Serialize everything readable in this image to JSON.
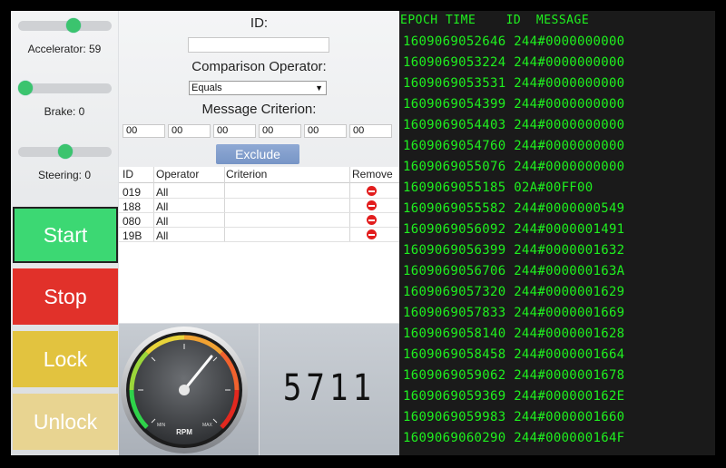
{
  "sliders": [
    {
      "label": "Accelerator: 59",
      "value_fraction": 0.59
    },
    {
      "label": "Brake: 0",
      "value_fraction": 0.0
    },
    {
      "label": "Steering: 0",
      "value_fraction": 0.5
    }
  ],
  "buttons": {
    "start": "Start",
    "stop": "Stop",
    "lock": "Lock",
    "unlock": "Unlock"
  },
  "colors": {
    "start": "#3cd873",
    "stop": "#e1312a",
    "lock": "#e2c33f",
    "unlock": "#e8d491",
    "log_text": "#1ff01f"
  },
  "filter": {
    "id_label": "ID:",
    "id_value": "",
    "operator_label": "Comparison Operator:",
    "operator_value": "Equals",
    "criterion_label": "Message Criterion:",
    "criteria": [
      "00",
      "00",
      "00",
      "00",
      "00",
      "00"
    ],
    "exclude_label": "Exclude"
  },
  "table": {
    "headers": [
      "ID",
      "Operator",
      "Criterion",
      "Remove"
    ],
    "rows": [
      {
        "id": "019",
        "operator": "All",
        "criterion": ""
      },
      {
        "id": "188",
        "operator": "All",
        "criterion": ""
      },
      {
        "id": "080",
        "operator": "All",
        "criterion": ""
      },
      {
        "id": "19B",
        "operator": "All",
        "criterion": ""
      }
    ]
  },
  "gauge": {
    "label": "RPM",
    "min": "MIN",
    "max": "MAX",
    "level_fraction": 0.65
  },
  "digital_display": "5711",
  "log": {
    "header": "EPOCH TIME    ID  MESSAGE",
    "lines": [
      "1609069052646 244#0000000000",
      "1609069053224 244#0000000000",
      "1609069053531 244#0000000000",
      "1609069054399 244#0000000000",
      "1609069054403 244#0000000000",
      "1609069054760 244#0000000000",
      "1609069055076 244#0000000000",
      "1609069055185 02A#00FF00",
      "1609069055582 244#0000000549",
      "1609069056092 244#0000001491",
      "1609069056399 244#0000001632",
      "1609069056706 244#000000163A",
      "1609069057320 244#0000001629",
      "1609069057833 244#0000001669",
      "1609069058140 244#0000001628",
      "1609069058458 244#0000001664",
      "1609069059062 244#0000001678",
      "1609069059369 244#000000162E",
      "1609069059983 244#0000001660",
      "1609069060290 244#000000164F"
    ]
  }
}
